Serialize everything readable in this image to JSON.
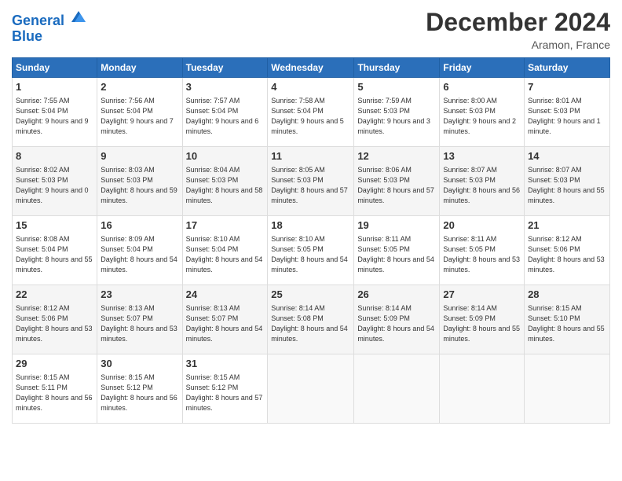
{
  "header": {
    "logo_line1": "General",
    "logo_line2": "Blue",
    "month": "December 2024",
    "location": "Aramon, France"
  },
  "weekdays": [
    "Sunday",
    "Monday",
    "Tuesday",
    "Wednesday",
    "Thursday",
    "Friday",
    "Saturday"
  ],
  "weeks": [
    [
      {
        "day": "1",
        "info": "Sunrise: 7:55 AM\nSunset: 5:04 PM\nDaylight: 9 hours and 9 minutes."
      },
      {
        "day": "2",
        "info": "Sunrise: 7:56 AM\nSunset: 5:04 PM\nDaylight: 9 hours and 7 minutes."
      },
      {
        "day": "3",
        "info": "Sunrise: 7:57 AM\nSunset: 5:04 PM\nDaylight: 9 hours and 6 minutes."
      },
      {
        "day": "4",
        "info": "Sunrise: 7:58 AM\nSunset: 5:04 PM\nDaylight: 9 hours and 5 minutes."
      },
      {
        "day": "5",
        "info": "Sunrise: 7:59 AM\nSunset: 5:03 PM\nDaylight: 9 hours and 3 minutes."
      },
      {
        "day": "6",
        "info": "Sunrise: 8:00 AM\nSunset: 5:03 PM\nDaylight: 9 hours and 2 minutes."
      },
      {
        "day": "7",
        "info": "Sunrise: 8:01 AM\nSunset: 5:03 PM\nDaylight: 9 hours and 1 minute."
      }
    ],
    [
      {
        "day": "8",
        "info": "Sunrise: 8:02 AM\nSunset: 5:03 PM\nDaylight: 9 hours and 0 minutes."
      },
      {
        "day": "9",
        "info": "Sunrise: 8:03 AM\nSunset: 5:03 PM\nDaylight: 8 hours and 59 minutes."
      },
      {
        "day": "10",
        "info": "Sunrise: 8:04 AM\nSunset: 5:03 PM\nDaylight: 8 hours and 58 minutes."
      },
      {
        "day": "11",
        "info": "Sunrise: 8:05 AM\nSunset: 5:03 PM\nDaylight: 8 hours and 57 minutes."
      },
      {
        "day": "12",
        "info": "Sunrise: 8:06 AM\nSunset: 5:03 PM\nDaylight: 8 hours and 57 minutes."
      },
      {
        "day": "13",
        "info": "Sunrise: 8:07 AM\nSunset: 5:03 PM\nDaylight: 8 hours and 56 minutes."
      },
      {
        "day": "14",
        "info": "Sunrise: 8:07 AM\nSunset: 5:03 PM\nDaylight: 8 hours and 55 minutes."
      }
    ],
    [
      {
        "day": "15",
        "info": "Sunrise: 8:08 AM\nSunset: 5:04 PM\nDaylight: 8 hours and 55 minutes."
      },
      {
        "day": "16",
        "info": "Sunrise: 8:09 AM\nSunset: 5:04 PM\nDaylight: 8 hours and 54 minutes."
      },
      {
        "day": "17",
        "info": "Sunrise: 8:10 AM\nSunset: 5:04 PM\nDaylight: 8 hours and 54 minutes."
      },
      {
        "day": "18",
        "info": "Sunrise: 8:10 AM\nSunset: 5:05 PM\nDaylight: 8 hours and 54 minutes."
      },
      {
        "day": "19",
        "info": "Sunrise: 8:11 AM\nSunset: 5:05 PM\nDaylight: 8 hours and 54 minutes."
      },
      {
        "day": "20",
        "info": "Sunrise: 8:11 AM\nSunset: 5:05 PM\nDaylight: 8 hours and 53 minutes."
      },
      {
        "day": "21",
        "info": "Sunrise: 8:12 AM\nSunset: 5:06 PM\nDaylight: 8 hours and 53 minutes."
      }
    ],
    [
      {
        "day": "22",
        "info": "Sunrise: 8:12 AM\nSunset: 5:06 PM\nDaylight: 8 hours and 53 minutes."
      },
      {
        "day": "23",
        "info": "Sunrise: 8:13 AM\nSunset: 5:07 PM\nDaylight: 8 hours and 53 minutes."
      },
      {
        "day": "24",
        "info": "Sunrise: 8:13 AM\nSunset: 5:07 PM\nDaylight: 8 hours and 54 minutes."
      },
      {
        "day": "25",
        "info": "Sunrise: 8:14 AM\nSunset: 5:08 PM\nDaylight: 8 hours and 54 minutes."
      },
      {
        "day": "26",
        "info": "Sunrise: 8:14 AM\nSunset: 5:09 PM\nDaylight: 8 hours and 54 minutes."
      },
      {
        "day": "27",
        "info": "Sunrise: 8:14 AM\nSunset: 5:09 PM\nDaylight: 8 hours and 55 minutes."
      },
      {
        "day": "28",
        "info": "Sunrise: 8:15 AM\nSunset: 5:10 PM\nDaylight: 8 hours and 55 minutes."
      }
    ],
    [
      {
        "day": "29",
        "info": "Sunrise: 8:15 AM\nSunset: 5:11 PM\nDaylight: 8 hours and 56 minutes."
      },
      {
        "day": "30",
        "info": "Sunrise: 8:15 AM\nSunset: 5:12 PM\nDaylight: 8 hours and 56 minutes."
      },
      {
        "day": "31",
        "info": "Sunrise: 8:15 AM\nSunset: 5:12 PM\nDaylight: 8 hours and 57 minutes."
      },
      null,
      null,
      null,
      null
    ]
  ]
}
